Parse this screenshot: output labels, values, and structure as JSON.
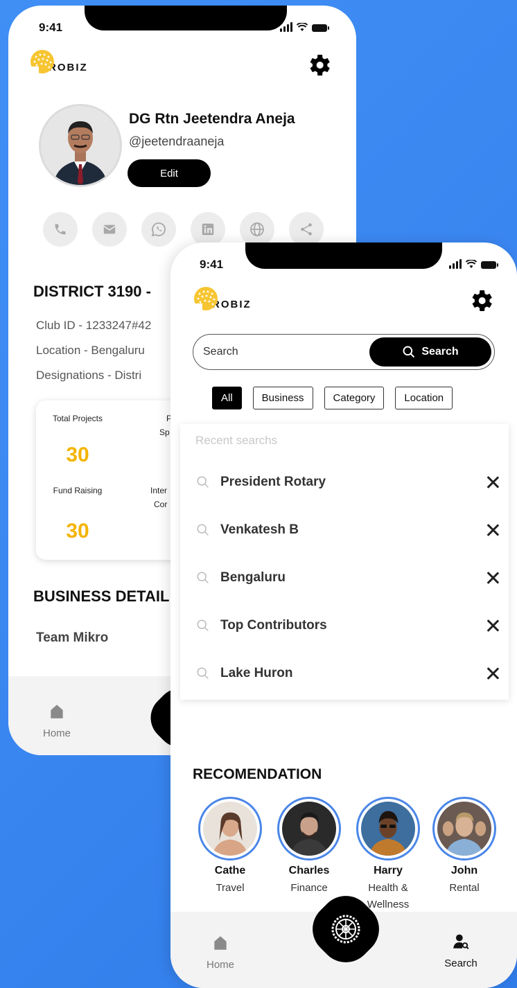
{
  "status": {
    "time": "9:41"
  },
  "brand": {
    "name": "ROBIZ"
  },
  "profile": {
    "name": "DG Rtn Jeetendra Aneja",
    "handle": "@jeetendraaneja",
    "edit_label": "Edit",
    "social_icons": [
      "phone-icon",
      "mail-icon",
      "whatsapp-icon",
      "linkedin-icon",
      "globe-icon",
      "share-icon"
    ],
    "district": "DISTRICT 3190 - ",
    "club_id": "Club ID - 1233247#42",
    "location": "Location -  Bengaluru",
    "designations": "Designations -  Distri"
  },
  "stats": [
    {
      "label": "Total Projects",
      "value": "30"
    },
    {
      "label": "Fund Raising",
      "value": "30"
    }
  ],
  "stats_cut_labels": [
    "P",
    "Sp",
    "Inter",
    "Cor"
  ],
  "business": {
    "title": "BUSINESS DETAIL",
    "team": "Team Mikro"
  },
  "nav": {
    "home": "Home",
    "search": "Search"
  },
  "search": {
    "placeholder": "Search",
    "button_label": "Search",
    "filters": [
      "All",
      "Business",
      "Category",
      "Location"
    ],
    "active_filter": "All"
  },
  "recent": {
    "title": "Recent searchs",
    "items": [
      "President Rotary",
      "Venkatesh B",
      "Bengaluru",
      "Top Contributors",
      "Lake Huron"
    ]
  },
  "recommendation": {
    "title": "RECOMENDATION",
    "people": [
      {
        "name": "Cathe",
        "category": "Travel"
      },
      {
        "name": "Charles",
        "category": "Finance"
      },
      {
        "name": "Harry",
        "category": "Health & Wellness"
      },
      {
        "name": "John",
        "category": "Rental"
      }
    ]
  },
  "colors": {
    "background": "#3a86f0",
    "accent": "#f4b400",
    "avatar_ring": "#4a86e8"
  }
}
